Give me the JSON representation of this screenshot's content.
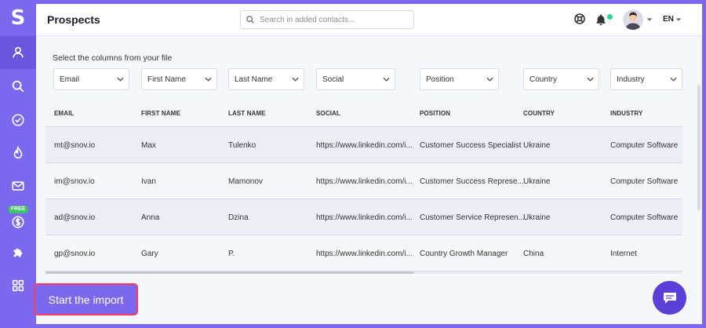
{
  "app": {
    "logo_letter": "S"
  },
  "sidebar": {
    "items": [
      {
        "name": "prospects",
        "icon": "user-icon",
        "active": true
      },
      {
        "name": "search",
        "icon": "search-icon"
      },
      {
        "name": "tasks",
        "icon": "check-circle-icon"
      },
      {
        "name": "drip",
        "icon": "flame-icon"
      },
      {
        "name": "email",
        "icon": "mail-icon"
      },
      {
        "name": "pricing",
        "icon": "dollar-icon",
        "badge": "FREE"
      },
      {
        "name": "integrations",
        "icon": "puzzle-icon"
      },
      {
        "name": "apps",
        "icon": "apps-grid-icon"
      }
    ]
  },
  "header": {
    "title": "Prospects",
    "search_placeholder": "Search in added contacts...",
    "language": "EN"
  },
  "import": {
    "subtitle": "Select the columns from your file",
    "selects": [
      "Email",
      "First Name",
      "Last Name",
      "Social",
      "Position",
      "Country",
      "Industry"
    ]
  },
  "table": {
    "headers": [
      "EMAIL",
      "FIRST NAME",
      "LAST NAME",
      "SOCIAL",
      "POSITION",
      "COUNTRY",
      "INDUSTRY"
    ],
    "rows": [
      [
        "mt@snov.io",
        "Max",
        "Tulenko",
        "https://www.linkedin.com/i...",
        "Customer Success Specialist",
        "Ukraine",
        "Computer Software"
      ],
      [
        "im@snov.io",
        "Ivan",
        "Mamonov",
        "https://www.linkedin.com/i...",
        "Customer Success Represe...",
        "Ukraine",
        "Computer Software"
      ],
      [
        "ad@snov.io",
        "Anna",
        "Dzina",
        "https://www.linkedin.com/i...",
        "Customer Service Represen...",
        "Ukraine",
        "Computer Software"
      ],
      [
        "gp@snov.io",
        "Gary",
        "P.",
        "https://www.linkedin.com/i...",
        "Country Growth Manager",
        "China",
        "Internet"
      ]
    ]
  },
  "actions": {
    "start_import": "Start the import"
  },
  "colors": {
    "accent": "#7b68ee",
    "highlight_border": "#ff3b5c",
    "notify_dot": "#2ad39b"
  }
}
